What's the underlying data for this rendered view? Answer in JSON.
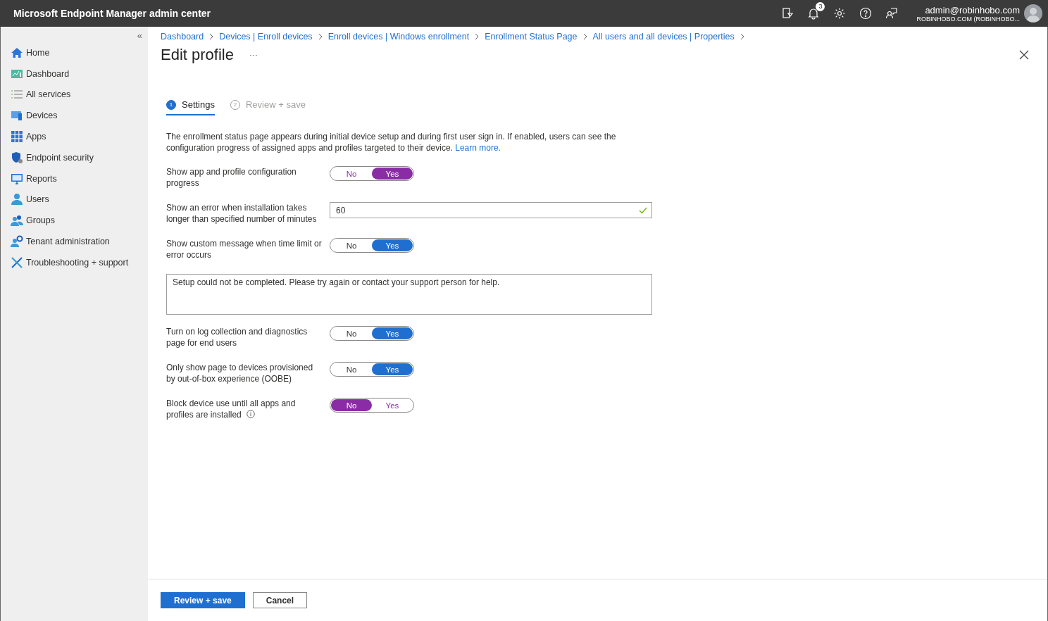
{
  "topbar": {
    "title": "Microsoft Endpoint Manager admin center",
    "notification_count": "3",
    "account": {
      "email": "admin@robinhobo.com",
      "tenant": "ROBINHOBO.COM (ROBINHOBO..."
    }
  },
  "sidebar": {
    "collapse": "«",
    "items": [
      {
        "label": "Home"
      },
      {
        "label": "Dashboard"
      },
      {
        "label": "All services"
      },
      {
        "label": "Devices"
      },
      {
        "label": "Apps"
      },
      {
        "label": "Endpoint security"
      },
      {
        "label": "Reports"
      },
      {
        "label": "Users"
      },
      {
        "label": "Groups"
      },
      {
        "label": "Tenant administration"
      },
      {
        "label": "Troubleshooting + support"
      }
    ]
  },
  "breadcrumb": [
    "Dashboard",
    "Devices | Enroll devices",
    "Enroll devices | Windows enrollment",
    "Enrollment Status Page",
    "All users and all devices | Properties"
  ],
  "page": {
    "title": "Edit profile",
    "more": "···"
  },
  "steps": [
    {
      "number": "1",
      "label": "Settings",
      "selected": true
    },
    {
      "number": "2",
      "label": "Review + save",
      "selected": false
    }
  ],
  "description": {
    "text": "The enrollment status page appears during initial device setup and during first user sign in. If enabled, users can see the configuration progress of assigned apps and profiles targeted to their device.",
    "link": "Learn more."
  },
  "settings": [
    {
      "kind": "toggle",
      "label": "Show app and profile configuration progress",
      "color": "#8a2da5",
      "options": [
        {
          "label": "No",
          "selected": false
        },
        {
          "label": "Yes",
          "selected": true
        }
      ]
    },
    {
      "kind": "number",
      "label": "Show an error when installation takes longer than specified number of minutes",
      "value": "60",
      "valid": true
    },
    {
      "kind": "toggle",
      "label": "Show custom message when time limit or error occurs",
      "color": "#1f6fd0",
      "options": [
        {
          "label": "No",
          "selected": false
        },
        {
          "label": "Yes",
          "selected": true
        }
      ]
    },
    {
      "kind": "message",
      "value": "Setup could not be completed. Please try again or contact your support person for help."
    },
    {
      "kind": "toggle",
      "label": "Turn on log collection and diagnostics page for end users",
      "color": "#1f6fd0",
      "options": [
        {
          "label": "No",
          "selected": false
        },
        {
          "label": "Yes",
          "selected": true
        }
      ]
    },
    {
      "kind": "toggle",
      "label": "Only show page to devices provisioned by out-of-box experience (OOBE)",
      "color": "#1f6fd0",
      "options": [
        {
          "label": "No",
          "selected": false
        },
        {
          "label": "Yes",
          "selected": true
        }
      ]
    },
    {
      "kind": "toggle",
      "label": "Block device use until all apps and profiles are installed",
      "info": true,
      "color": "#8a2da5",
      "options": [
        {
          "label": "No",
          "selected": true
        },
        {
          "label": "Yes",
          "selected": false
        }
      ]
    }
  ],
  "footer": {
    "primary": "Review + save",
    "secondary": "Cancel"
  }
}
